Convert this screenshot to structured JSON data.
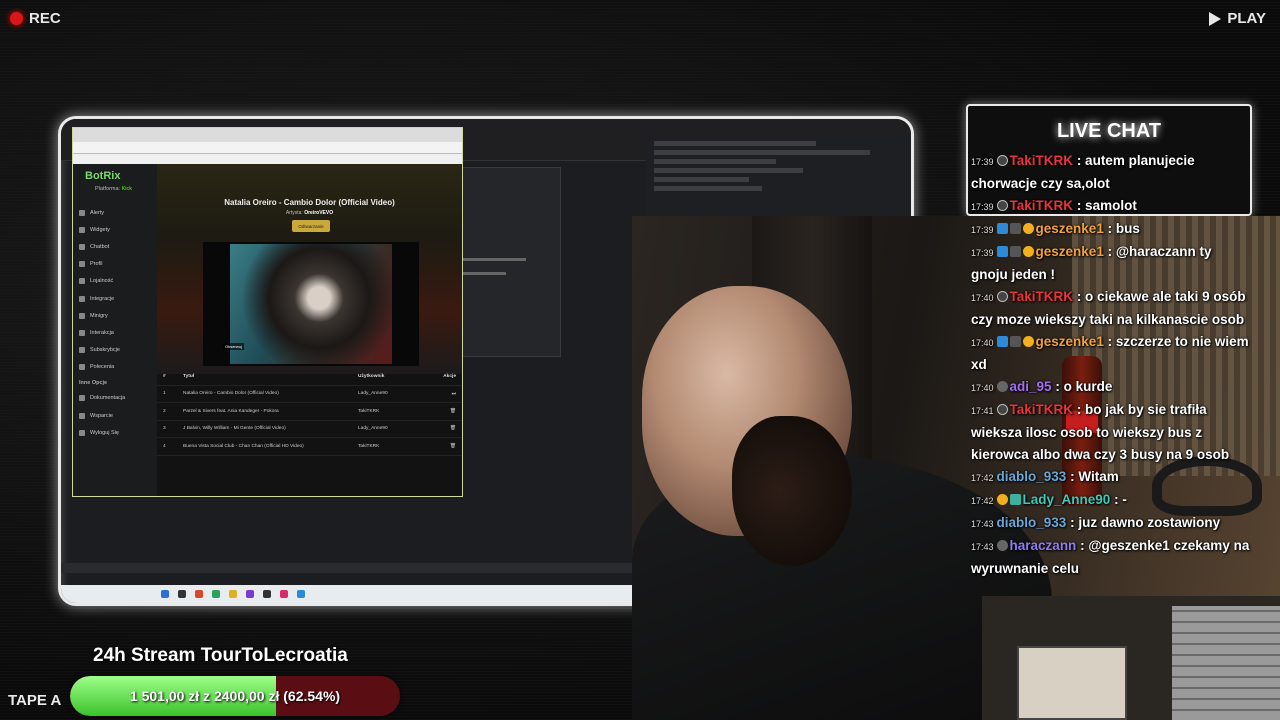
{
  "overlay": {
    "rec_label": "REC",
    "play_label": "PLAY",
    "tape_label": "TAPE A"
  },
  "stream": {
    "title": "24h Stream TourToLecroatia",
    "goal_text": "1 501,00 zł z 2400,00 zł (62.54%)",
    "goal_fraction": 0.6254,
    "goal_color": "#5fd34a",
    "goal_bg_color": "#5a0e14"
  },
  "chat": {
    "title": "LIVE CHAT",
    "messages": [
      {
        "time": "17:39",
        "user": "TakiTKRK",
        "color": "#e8343c",
        "icons": [
          "x"
        ],
        "text": ": autem planujecie chorwacje czy sa,olot"
      },
      {
        "time": "17:39",
        "user": "TakiTKRK",
        "color": "#e8343c",
        "icons": [
          "x"
        ],
        "text": ": samolot"
      },
      {
        "time": "17:39",
        "user": "geszenke1",
        "color": "#f2a23a",
        "icons": [
          "arr",
          "dev",
          "one"
        ],
        "text": ": bus"
      },
      {
        "time": "17:39",
        "user": "geszenke1",
        "color": "#f2a23a",
        "icons": [
          "arr",
          "dev",
          "one"
        ],
        "text": ": @haraczann ty gnoju jeden !"
      },
      {
        "time": "17:40",
        "user": "TakiTKRK",
        "color": "#e8343c",
        "icons": [
          "x"
        ],
        "text": ": o ciekawe ale taki 9 osób czy moze wiekszy taki na kilkanascie osob"
      },
      {
        "time": "17:40",
        "user": "geszenke1",
        "color": "#f2a23a",
        "icons": [
          "arr",
          "dev",
          "one"
        ],
        "text": ": szczerze to nie wiem xd"
      },
      {
        "time": "17:40",
        "user": "adi_95",
        "color": "#a66cf0",
        "icons": [
          "sh"
        ],
        "text": ": o kurde"
      },
      {
        "time": "17:41",
        "user": "TakiTKRK",
        "color": "#e8343c",
        "icons": [
          "x"
        ],
        "text": ": bo jak by sie trafiła wieksza ilosc osob to wiekszy bus z kierowca albo dwa czy 3 busy na 9 osob"
      },
      {
        "time": "17:42",
        "user": "diablo_933",
        "color": "#6aa6d8",
        "icons": [],
        "text": ": Witam"
      },
      {
        "time": "17:42",
        "user": "Lady_Anne90",
        "color": "#3fc9b8",
        "icons": [
          "one",
          "hex"
        ],
        "text": ": -"
      },
      {
        "time": "17:43",
        "user": "diablo_933",
        "color": "#6aa6d8",
        "icons": [],
        "text": ": juz dawno zostawiony"
      },
      {
        "time": "17:43",
        "user": "haraczann",
        "color": "#8f7cf0",
        "icons": [
          "sh"
        ],
        "text": ": @geszenke1 czekamy na wyruwnanie celu"
      }
    ]
  },
  "botrix": {
    "logo": "BotRix",
    "platform_label": "Platforma:",
    "platform_value": "Kick",
    "menu": [
      "Alerty",
      "Widgety",
      "Chatbot",
      "Profil",
      "Lojalność",
      "Integracje",
      "Minigry",
      "Interakcja",
      "Subskrybcje",
      "Polecenia"
    ],
    "other_header": "Inne Opcje",
    "other_menu": [
      "Dokumentacja",
      "Wsparcie",
      "Wyloguj Się"
    ],
    "now_playing": {
      "title": "Natalia Oreiro - Cambio Dolor (Official Video)",
      "artist_label": "Artysta:",
      "artist": "OreiroVEVO",
      "skip_label": "Odtwarzanie",
      "video_tag": "Obserwuj"
    },
    "queue_headers": [
      "#",
      "Tytuł",
      "Użytkownik",
      "Akcje"
    ],
    "queue": [
      {
        "n": "1",
        "title": "Natalia Oreiro - Cambio Dolor (Official Video)",
        "user": "Lady_Anne90",
        "act": "⏭"
      },
      {
        "n": "2",
        "title": "Parzel & Sivers feat. Ania Kandeger - Pokora",
        "user": "TakiTKRK",
        "act": "🗑"
      },
      {
        "n": "3",
        "title": "J Balvin, Willy William - Mi Gente (Official Video)",
        "user": "Lady_Anne90",
        "act": "🗑"
      },
      {
        "n": "4",
        "title": "Buena Vista Social Club - Chan Chan (Official HD Video)",
        "user": "TakiTKRK",
        "act": "🗑"
      }
    ]
  }
}
